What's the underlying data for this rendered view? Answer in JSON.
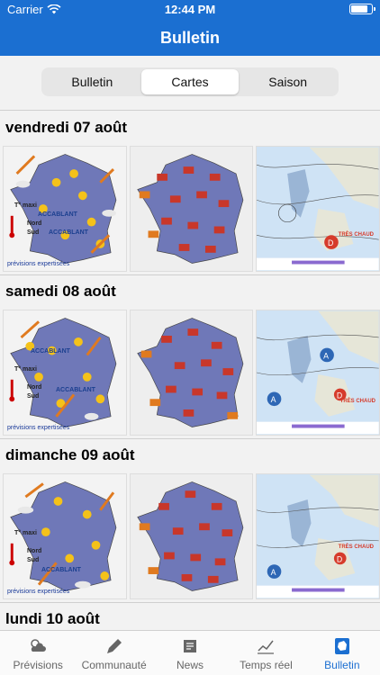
{
  "status": {
    "carrier": "Carrier",
    "time": "12:44 PM"
  },
  "header": {
    "title": "Bulletin"
  },
  "segments": [
    {
      "label": "Bulletin"
    },
    {
      "label": "Cartes"
    },
    {
      "label": "Saison"
    }
  ],
  "days": [
    {
      "title": "vendredi 07 août"
    },
    {
      "title": "samedi 08 août"
    },
    {
      "title": "dimanche 09 août"
    },
    {
      "title": "lundi 10 août"
    }
  ],
  "map_texts": {
    "accablant": "ACCABLANT",
    "tmaxi": "T° maxi",
    "nord": "Nord",
    "sud": "Sud",
    "expertisees": "prévisions expertisées",
    "tres_chaud": "TRÈS CHAUD"
  },
  "tabs": [
    {
      "label": "Prévisions"
    },
    {
      "label": "Communauté"
    },
    {
      "label": "News"
    },
    {
      "label": "Temps réel"
    },
    {
      "label": "Bulletin"
    }
  ],
  "colors": {
    "primary": "#1b6fd1",
    "france": "#6f78b8",
    "hot_label": "#d63b2b"
  }
}
